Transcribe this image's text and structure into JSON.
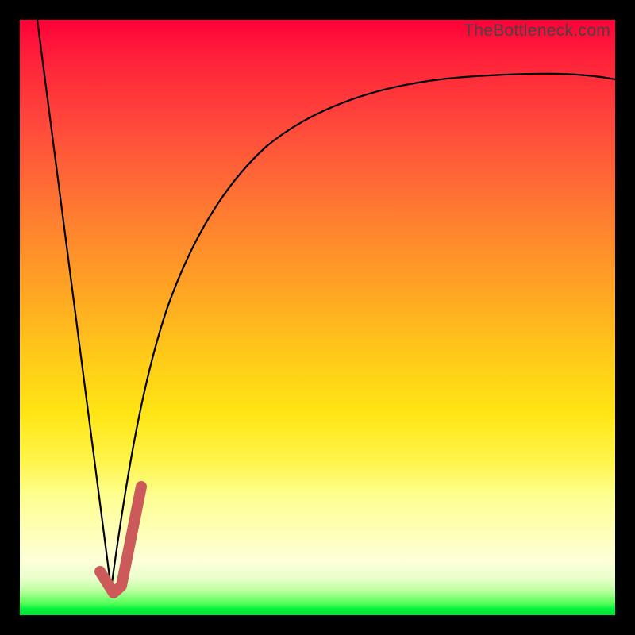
{
  "watermark": "TheBottleneck.com",
  "chart_data": {
    "type": "line",
    "title": "",
    "xlabel": "",
    "ylabel": "",
    "xlim": [
      0,
      100
    ],
    "ylim": [
      0,
      100
    ],
    "series": [
      {
        "name": "left-descending-line",
        "x": [
          3,
          15
        ],
        "y": [
          100,
          5
        ]
      },
      {
        "name": "right-rising-curve",
        "x": [
          15,
          17,
          20,
          23,
          27,
          32,
          38,
          46,
          56,
          70,
          85,
          100
        ],
        "y": [
          5,
          20,
          37,
          49,
          60,
          68,
          75,
          80,
          84,
          87,
          89,
          90
        ]
      },
      {
        "name": "highlight-j-segment",
        "x": [
          14,
          16,
          17,
          20
        ],
        "y": [
          6,
          4,
          5,
          22
        ]
      }
    ],
    "background_gradient": {
      "top": "#ff0038",
      "mid_upper": "#ffa324",
      "mid": "#fff44a",
      "mid_lower": "#feffd8",
      "bottom": "#00e53a"
    }
  }
}
